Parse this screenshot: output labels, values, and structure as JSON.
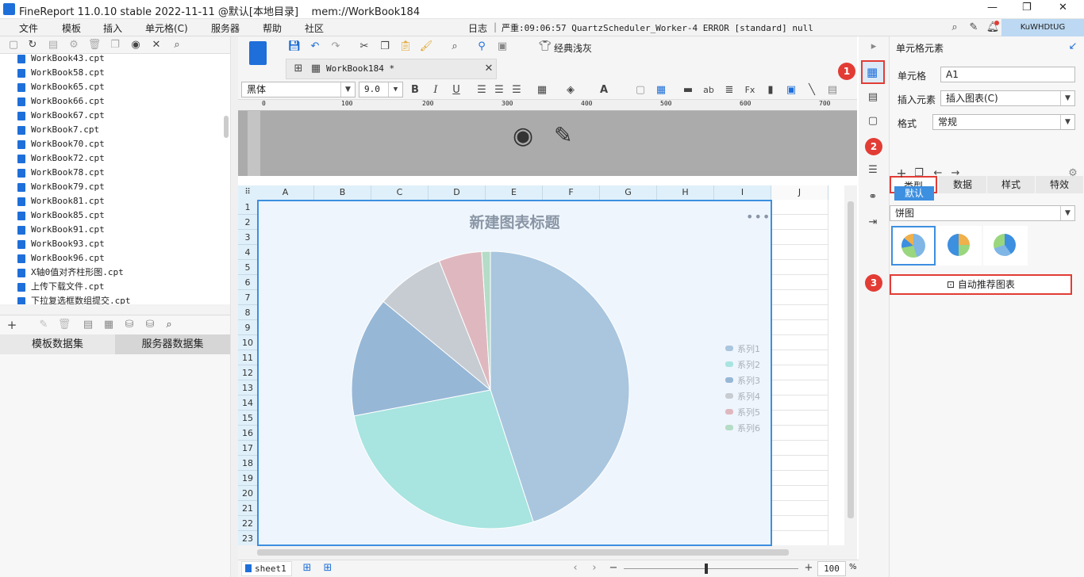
{
  "window": {
    "title": "FineReport 11.0.10 stable 2022-11-11 @默认[本地目录]    mem://WorkBook184",
    "window_controls": [
      "—",
      "❐",
      "✕"
    ]
  },
  "menu": {
    "items": [
      "文件",
      "模板",
      "插入",
      "单元格(C)",
      "服务器",
      "帮助",
      "社区"
    ]
  },
  "log": {
    "label": "日志",
    "text": "严重:09:06:57 QuartzScheduler_Worker-4 ERROR [standard] null"
  },
  "user": {
    "name": "KuWHDtUG"
  },
  "files": [
    "WorkBook43.cpt",
    "WorkBook58.cpt",
    "WorkBook65.cpt",
    "WorkBook66.cpt",
    "WorkBook67.cpt",
    "WorkBook7.cpt",
    "WorkBook70.cpt",
    "WorkBook72.cpt",
    "WorkBook78.cpt",
    "WorkBook79.cpt",
    "WorkBook81.cpt",
    "WorkBook85.cpt",
    "WorkBook91.cpt",
    "WorkBook93.cpt",
    "WorkBook96.cpt",
    "X轴0值对齐柱形图.cpt",
    "上传下载文件.cpt",
    "下拉复选框数组提交.cpt"
  ],
  "datasets": {
    "tab1": "模板数据集",
    "tab2": "服务器数据集"
  },
  "toolbar": {
    "theme": "经典浅灰"
  },
  "doc_tab": {
    "name": "WorkBook184 *"
  },
  "format": {
    "font": "黑体",
    "size": "9.0"
  },
  "ruler": {
    "ticks": [
      "0",
      "100",
      "200",
      "300",
      "400",
      "500",
      "600",
      "700"
    ]
  },
  "columns": [
    "A",
    "B",
    "C",
    "D",
    "E",
    "F",
    "G",
    "H",
    "I",
    "J"
  ],
  "rows": [
    "1",
    "2",
    "3",
    "4",
    "5",
    "6",
    "7",
    "8",
    "9",
    "10",
    "11",
    "12",
    "13",
    "14",
    "15",
    "16",
    "17",
    "18",
    "19",
    "20",
    "21",
    "22",
    "23"
  ],
  "sheet": {
    "name": "sheet1"
  },
  "zoom": {
    "value": "100",
    "unit": "%"
  },
  "chart_data": {
    "type": "pie",
    "title": "新建图表标题",
    "series": [
      {
        "name": "系列1",
        "value": 45,
        "color": "#a9c6de"
      },
      {
        "name": "系列2",
        "value": 27,
        "color": "#a8e4e0"
      },
      {
        "name": "系列3",
        "value": 14,
        "color": "#97b7d6"
      },
      {
        "name": "系列4",
        "value": 8,
        "color": "#c6ccd2"
      },
      {
        "name": "系列5",
        "value": 5,
        "color": "#dfb8bf"
      },
      {
        "name": "系列6",
        "value": 1,
        "color": "#b4dcc6"
      }
    ],
    "legend": "right"
  },
  "panel": {
    "title": "单元格元素",
    "cell_label": "单元格",
    "cell_value": "A1",
    "insert_label": "插入元素",
    "insert_value": "插入图表(C)",
    "format_label": "格式",
    "format_value": "常规",
    "tabs": [
      "类型",
      "数据",
      "样式",
      "特效"
    ],
    "default_tag": "默认",
    "chart_type": "饼图",
    "auto_button": "自动推荐图表"
  },
  "badges": [
    "1",
    "2",
    "3"
  ],
  "colors": {
    "accent": "#3d8fe0",
    "badge": "#e23c35"
  }
}
